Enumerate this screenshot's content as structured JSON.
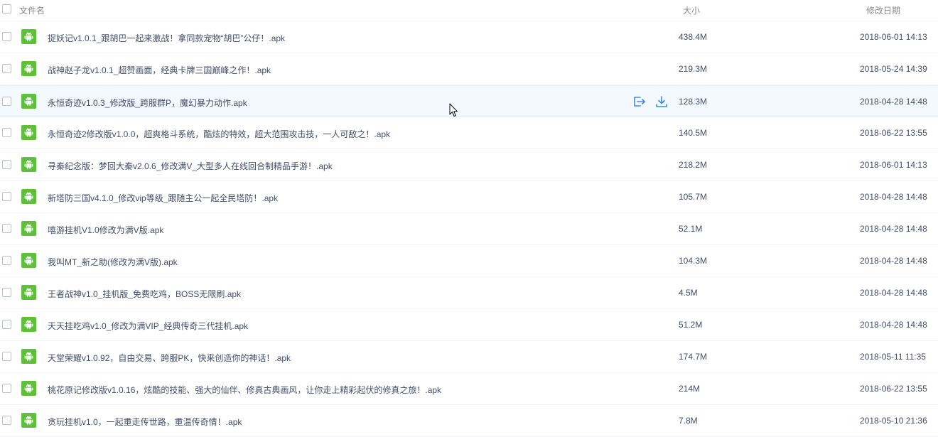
{
  "header": {
    "name_label": "文件名",
    "size_label": "大小",
    "date_label": "修改日期"
  },
  "files": [
    {
      "name": "捉妖记v1.0.1_跟胡巴一起来激战！拿同款宠物“胡巴”公仔！.apk",
      "size": "438.4M",
      "date": "2018-06-01 14:13"
    },
    {
      "name": "战神赵子龙v1.0.1_超赞画面，经典卡牌三国巅峰之作！.apk",
      "size": "219.3M",
      "date": "2018-05-24 14:39"
    },
    {
      "name": "永恒奇迹v1.0.3_修改版_跨服群P，魔幻暴力动作.apk",
      "size": "128.3M",
      "date": "2018-04-28 14:48"
    },
    {
      "name": "永恒奇迹2修改版v1.0.0，超爽格斗系统，酷炫的特效，超大范围攻击技，一人可敌之！.apk",
      "size": "140.5M",
      "date": "2018-06-22 13:55"
    },
    {
      "name": "寻秦纪念版：梦回大秦v2.0.6_修改满V_大型多人在线回合制精品手游！.apk",
      "size": "218.2M",
      "date": "2018-06-01 14:13"
    },
    {
      "name": "新塔防三国v4.1.0_修改vip等级_跟随主公一起全民塔防！.apk",
      "size": "105.7M",
      "date": "2018-04-28 14:48"
    },
    {
      "name": "嘻游挂机V1.0修改为满V版.apk",
      "size": "52.1M",
      "date": "2018-04-28 14:48"
    },
    {
      "name": "我叫MT_新之助(修改为满V版).apk",
      "size": "104.3M",
      "date": "2018-04-28 14:48"
    },
    {
      "name": "王者战神v1.0_挂机版_免费吃鸡，BOSS无限刷.apk",
      "size": "4.5M",
      "date": "2018-04-28 14:48"
    },
    {
      "name": "天天挂吃鸡v1.0_修改为满VIP_经典传奇三代挂机.apk",
      "size": "51.2M",
      "date": "2018-04-28 14:48"
    },
    {
      "name": "天堂荣耀v1.0.92，自由交易、跨服PK，快来创造你的神话！.apk",
      "size": "174.7M",
      "date": "2018-05-11 11:35"
    },
    {
      "name": "桃花原记修改版v1.0.16，炫酷的技能、强大的仙伴、修真古典画风，让你走上精彩起伏的修真之旅！.apk",
      "size": "214M",
      "date": "2018-06-22 13:55"
    },
    {
      "name": "贪玩挂机v1.0，一起重走传世路，重温传奇情！.apk",
      "size": "7.8M",
      "date": "2018-05-10 21:36"
    }
  ],
  "hover_row_index": 2,
  "colors": {
    "android_icon": "#5fbf3a",
    "action_icon": "#3b8cde",
    "hover_bg": "#f4f8ff"
  },
  "icons": {
    "file_type": "android-icon",
    "share": "share-icon",
    "download": "download-icon",
    "cursor": "mouse-cursor-icon"
  }
}
